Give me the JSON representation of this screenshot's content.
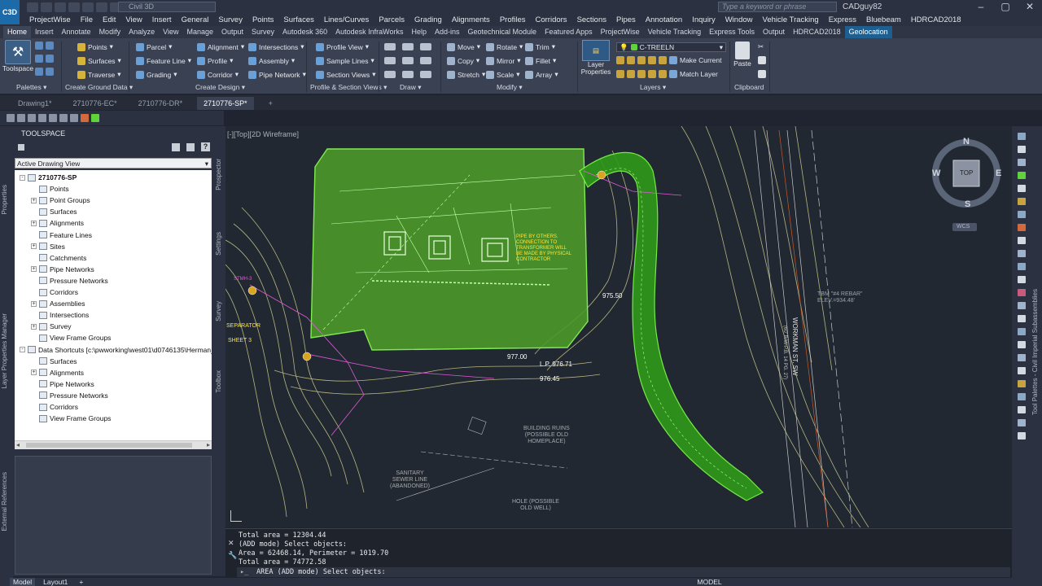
{
  "title_bar": {
    "app_logo_text": "C3D",
    "workspace_value": "Civil 3D",
    "search_placeholder": "Type a keyword or phrase",
    "user": "CADguy82"
  },
  "menus": [
    "ProjectWise",
    "File",
    "Edit",
    "View",
    "Insert",
    "General",
    "Survey",
    "Points",
    "Surfaces",
    "Lines/Curves",
    "Parcels",
    "Grading",
    "Alignments",
    "Profiles",
    "Corridors",
    "Sections",
    "Pipes",
    "Annotation",
    "Inquiry",
    "Window",
    "Vehicle Tracking",
    "Express",
    "Bluebeam",
    "HDRCAD2018"
  ],
  "ribbon_tabs": [
    "Home",
    "Insert",
    "Annotate",
    "Modify",
    "Analyze",
    "View",
    "Manage",
    "Output",
    "Survey",
    "Autodesk 360",
    "Autodesk InfraWorks",
    "Help",
    "Add-ins",
    "Geotechnical Module",
    "Featured Apps",
    "ProjectWise",
    "Vehicle Tracking",
    "Express Tools",
    "Output",
    "HDRCAD2018",
    "Geolocation"
  ],
  "ribbon": {
    "toolspace": "Toolspace",
    "palettes": "Palettes",
    "create_ground": [
      "Points",
      "Surfaces",
      "Traverse"
    ],
    "create_ground_title": "Create Ground Data",
    "design_col1": [
      "Parcel",
      "Feature Line",
      "Grading"
    ],
    "design_col2": [
      "Alignment",
      "Profile",
      "Corridor"
    ],
    "design_col3": [
      "Intersections",
      "Assembly",
      "Pipe Network"
    ],
    "create_design_title": "Create Design",
    "profile_section": [
      "Profile View",
      "Sample Lines",
      "Section Views"
    ],
    "profile_section_title": "Profile & Section Views",
    "draw_title": "Draw",
    "modify_col1": [
      "Move",
      "Copy",
      "Stretch"
    ],
    "modify_col2": [
      "Rotate",
      "Mirror",
      "Scale"
    ],
    "modify_col3": [
      "Trim",
      "Fillet",
      "Array"
    ],
    "modify_title": "Modify",
    "layer_properties": "Layer Properties",
    "layer_current": "C-TREELN",
    "layer_buttons": [
      "Make Current",
      "Match Layer"
    ],
    "layers_title": "Layers",
    "paste": "Paste",
    "clipboard_title": "Clipboard"
  },
  "doc_tabs": [
    "Drawing1*",
    "2710776-EC*",
    "2710776-DR*",
    "2710776-SP*"
  ],
  "doc_tab_add": "+",
  "toolspace": {
    "title": "TOOLSPACE",
    "view_select": "Active Drawing View",
    "side_tabs": [
      "Prospector",
      "Settings",
      "Survey",
      "Toolbox"
    ],
    "tree": [
      {
        "label": "2710776-SP",
        "level": 0,
        "exp": "-",
        "bold": true
      },
      {
        "label": "Points",
        "level": 1,
        "exp": ""
      },
      {
        "label": "Point Groups",
        "level": 1,
        "exp": "+"
      },
      {
        "label": "Surfaces",
        "level": 1,
        "exp": ""
      },
      {
        "label": "Alignments",
        "level": 1,
        "exp": "+"
      },
      {
        "label": "Feature Lines",
        "level": 1,
        "exp": ""
      },
      {
        "label": "Sites",
        "level": 1,
        "exp": "+"
      },
      {
        "label": "Catchments",
        "level": 1,
        "exp": ""
      },
      {
        "label": "Pipe Networks",
        "level": 1,
        "exp": "+"
      },
      {
        "label": "Pressure Networks",
        "level": 1,
        "exp": ""
      },
      {
        "label": "Corridors",
        "level": 1,
        "exp": ""
      },
      {
        "label": "Assemblies",
        "level": 1,
        "exp": "+"
      },
      {
        "label": "Intersections",
        "level": 1,
        "exp": ""
      },
      {
        "label": "Survey",
        "level": 1,
        "exp": "+"
      },
      {
        "label": "View Frame Groups",
        "level": 1,
        "exp": ""
      },
      {
        "label": "Data Shortcuts [c:\\pwworking\\west01\\d0746135\\Herman_...",
        "level": 0,
        "exp": "-"
      },
      {
        "label": "Surfaces",
        "level": 1,
        "exp": ""
      },
      {
        "label": "Alignments",
        "level": 1,
        "exp": "+"
      },
      {
        "label": "Pipe Networks",
        "level": 1,
        "exp": ""
      },
      {
        "label": "Pressure Networks",
        "level": 1,
        "exp": ""
      },
      {
        "label": "Corridors",
        "level": 1,
        "exp": ""
      },
      {
        "label": "View Frame Groups",
        "level": 1,
        "exp": ""
      }
    ]
  },
  "left_strip_tabs": [
    "Properties",
    "Layer Properties Manager",
    "External References"
  ],
  "viewport": {
    "label": "[-][Top][2D Wireframe]",
    "compass": {
      "n": "N",
      "s": "S",
      "e": "E",
      "w": "W",
      "top": "TOP",
      "wcs": "WCS"
    },
    "annotations": {
      "pipe_by_others": [
        "PIPE BY OTHERS.",
        "CONNECTION TO",
        "TRANSFORMER WILL",
        "BE MADE BY PHYSICAL",
        "CONTRACTOR"
      ],
      "elev_977": "977.00",
      "elev_975": "975.50",
      "elev_976": "976.45",
      "lp": "L.P. 976.71",
      "tbm": [
        "TBM \"#4 REBAR\"",
        "ELEV.=934.48'"
      ],
      "street": "WORKMAN ST. SW",
      "street_sub": "(60' R/W-P.B. 14 PG. 27)",
      "ruins": [
        "BUILDING RUINS",
        "(POSSIBLE OLD",
        "HOMEPLACE)"
      ],
      "sewer": [
        "SANITARY",
        "SEWER LINE",
        "(ABANDONED)"
      ],
      "hole": [
        "HOLE (POSSIBLE",
        "OLD WELL)"
      ],
      "separator": "SEPARATOR",
      "sheet": "SHEET 3",
      "stmh": "STMH-3"
    }
  },
  "right_palette_labels": [
    "Tool Palettes - Civil Imperial Subassemblies"
  ],
  "command_line": {
    "history": [
      "Total area = 12304.44",
      "(ADD mode) Select objects:",
      "Area = 62468.14, Perimeter = 1019.70",
      "Total area = 74772.58"
    ],
    "prompt": "AREA (ADD mode) Select objects:"
  },
  "status_bar": {
    "tabs": [
      "Model",
      "Layout1"
    ],
    "add": "+",
    "mode": "MODEL"
  },
  "colors": {
    "accent": "#1c6aa8",
    "green": "#5fd43a",
    "grid_bg": "#212831"
  }
}
